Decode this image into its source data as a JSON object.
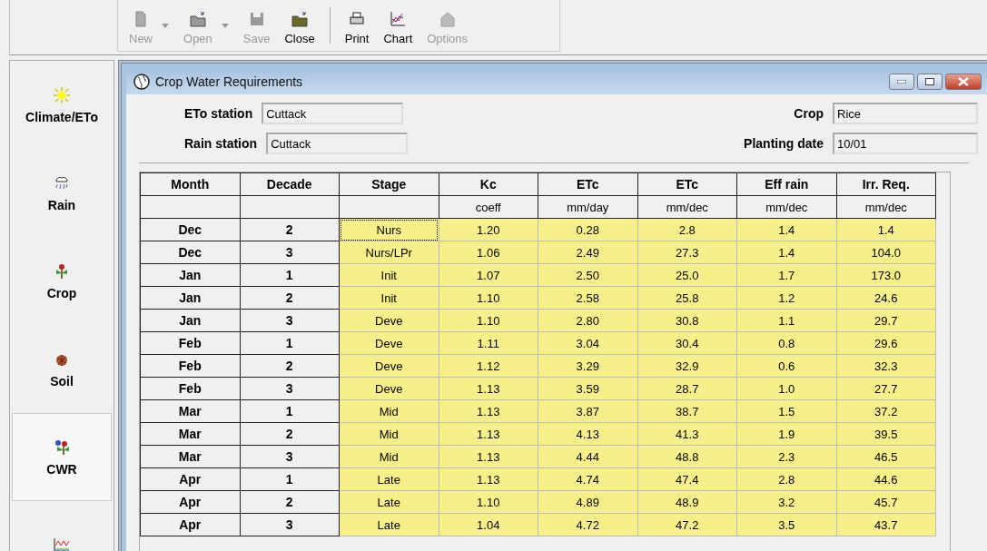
{
  "toolbar": [
    {
      "label": "New",
      "disabled": true,
      "dropdown": true
    },
    {
      "label": "Open",
      "disabled": true,
      "dropdown": true
    },
    {
      "label": "Save",
      "disabled": true,
      "dropdown": false
    },
    {
      "label": "Close",
      "disabled": false,
      "dropdown": false
    },
    {
      "label": "Print",
      "disabled": false,
      "dropdown": false
    },
    {
      "label": "Chart",
      "disabled": false,
      "dropdown": false
    },
    {
      "label": "Options",
      "disabled": true,
      "dropdown": false
    }
  ],
  "sidebar": {
    "items": [
      {
        "label": "Climate/ETo",
        "selected": false
      },
      {
        "label": "Rain",
        "selected": false
      },
      {
        "label": "Crop",
        "selected": false
      },
      {
        "label": "Soil",
        "selected": false
      },
      {
        "label": "CWR",
        "selected": true
      },
      {
        "selected": false
      }
    ]
  },
  "window": {
    "title": "Crop Water Requirements",
    "fields": [
      {
        "label": "ETo station",
        "value": "Cuttack"
      },
      {
        "label": "Crop",
        "value": "Rice"
      },
      {
        "label": "Rain station",
        "value": "Cuttack"
      },
      {
        "label": "Planting date",
        "value": "10/01"
      }
    ]
  },
  "table": {
    "columns": [
      {
        "heading": "Month",
        "kind": "key"
      },
      {
        "heading": "Decade",
        "kind": "key"
      },
      {
        "heading": "Stage",
        "kind": "value"
      },
      {
        "heading": "Kc",
        "unit": "coeff",
        "kind": "value"
      },
      {
        "heading": "ETc",
        "unit": "mm/day",
        "kind": "value"
      },
      {
        "heading": "ETc",
        "unit": "mm/dec",
        "kind": "value"
      },
      {
        "heading": "Eff rain",
        "unit": "mm/dec",
        "kind": "value"
      },
      {
        "heading": "Irr. Req.",
        "unit": "mm/dec",
        "kind": "value"
      }
    ],
    "rows": [
      {
        "cells": [
          "Dec",
          "2",
          "Nurs",
          "1.20",
          "0.28",
          "2.8",
          "1.4",
          "1.4"
        ],
        "focused": true
      },
      {
        "cells": [
          "Dec",
          "3",
          "Nurs/LPr",
          "1.06",
          "2.49",
          "27.3",
          "1.4",
          "104.0"
        ],
        "focused": false
      },
      {
        "cells": [
          "Jan",
          "1",
          "Init",
          "1.07",
          "2.50",
          "25.0",
          "1.7",
          "173.0"
        ],
        "focused": false
      },
      {
        "cells": [
          "Jan",
          "2",
          "Init",
          "1.10",
          "2.58",
          "25.8",
          "1.2",
          "24.6"
        ],
        "focused": false
      },
      {
        "cells": [
          "Jan",
          "3",
          "Deve",
          "1.10",
          "2.80",
          "30.8",
          "1.1",
          "29.7"
        ],
        "focused": false
      },
      {
        "cells": [
          "Feb",
          "1",
          "Deve",
          "1.11",
          "3.04",
          "30.4",
          "0.8",
          "29.6"
        ],
        "focused": false
      },
      {
        "cells": [
          "Feb",
          "2",
          "Deve",
          "1.12",
          "3.29",
          "32.9",
          "0.6",
          "32.3"
        ],
        "focused": false
      },
      {
        "cells": [
          "Feb",
          "3",
          "Deve",
          "1.13",
          "3.59",
          "28.7",
          "1.0",
          "27.7"
        ],
        "focused": false
      },
      {
        "cells": [
          "Mar",
          "1",
          "Mid",
          "1.13",
          "3.87",
          "38.7",
          "1.5",
          "37.2"
        ],
        "focused": false
      },
      {
        "cells": [
          "Mar",
          "2",
          "Mid",
          "1.13",
          "4.13",
          "41.3",
          "1.9",
          "39.5"
        ],
        "focused": false
      },
      {
        "cells": [
          "Mar",
          "3",
          "Mid",
          "1.13",
          "4.44",
          "48.8",
          "2.3",
          "46.5"
        ],
        "focused": false
      },
      {
        "cells": [
          "Apr",
          "1",
          "Late",
          "1.13",
          "4.74",
          "47.4",
          "2.8",
          "44.6"
        ],
        "focused": false
      },
      {
        "cells": [
          "Apr",
          "2",
          "Late",
          "1.10",
          "4.89",
          "48.9",
          "3.2",
          "45.7"
        ],
        "focused": false
      },
      {
        "cells": [
          "Apr",
          "3",
          "Late",
          "1.04",
          "4.72",
          "47.2",
          "3.5",
          "43.7"
        ],
        "focused": false
      }
    ]
  }
}
